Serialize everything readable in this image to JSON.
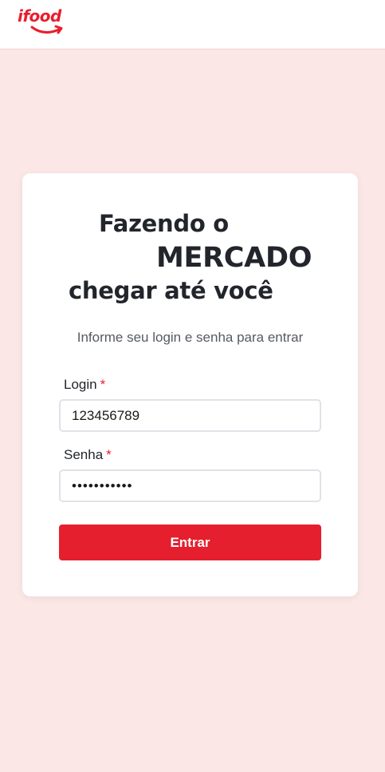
{
  "header": {
    "logo_text": "ifood"
  },
  "login_card": {
    "headline": {
      "line1": "Fazendo o",
      "line2": "MERCADO",
      "line3": "chegar até você"
    },
    "subtitle": "Informe seu login e senha para entrar",
    "login_field": {
      "label": "Login",
      "required_mark": "*",
      "value": "123456789"
    },
    "password_field": {
      "label": "Senha",
      "required_mark": "*",
      "value": "•••••••••••"
    },
    "submit_label": "Entrar"
  },
  "colors": {
    "brand": "#ea1d2c",
    "page_background": "#fbe7e6",
    "card_background": "#ffffff",
    "text": "#22252b"
  }
}
